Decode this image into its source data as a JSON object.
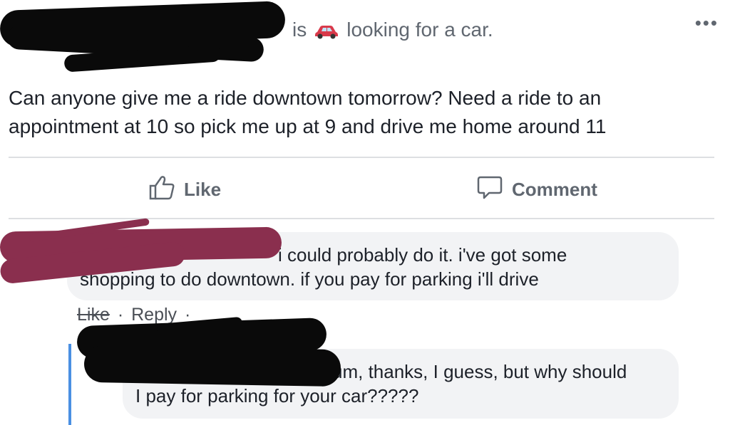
{
  "post": {
    "status_prefix": "is",
    "status_icon": "car-icon",
    "status_text": "looking for a car.",
    "more_label": "•••",
    "body_line1": "Can anyone give me a ride downtown tomorrow? Need a ride to an",
    "body_line2": "appointment at 10 so pick me up at 9 and drive me home around 11"
  },
  "actions": {
    "like_label": "Like",
    "comment_label": "Comment"
  },
  "comments": [
    {
      "line1": "i could probably do it. i've got some",
      "line2": "shopping to do downtown. if you pay for parking i'll drive",
      "meta_like": "Like",
      "meta_reply": "Reply",
      "meta_sep": "·"
    },
    {
      "line1": "um, thanks, I guess, but why should",
      "line2": "I pay for parking for your car?????"
    }
  ],
  "colors": {
    "accent": "#4a90e2",
    "bubble": "#f2f3f5",
    "redaction_black": "#0a0a0a",
    "redaction_maroon": "#8a2f4e"
  }
}
